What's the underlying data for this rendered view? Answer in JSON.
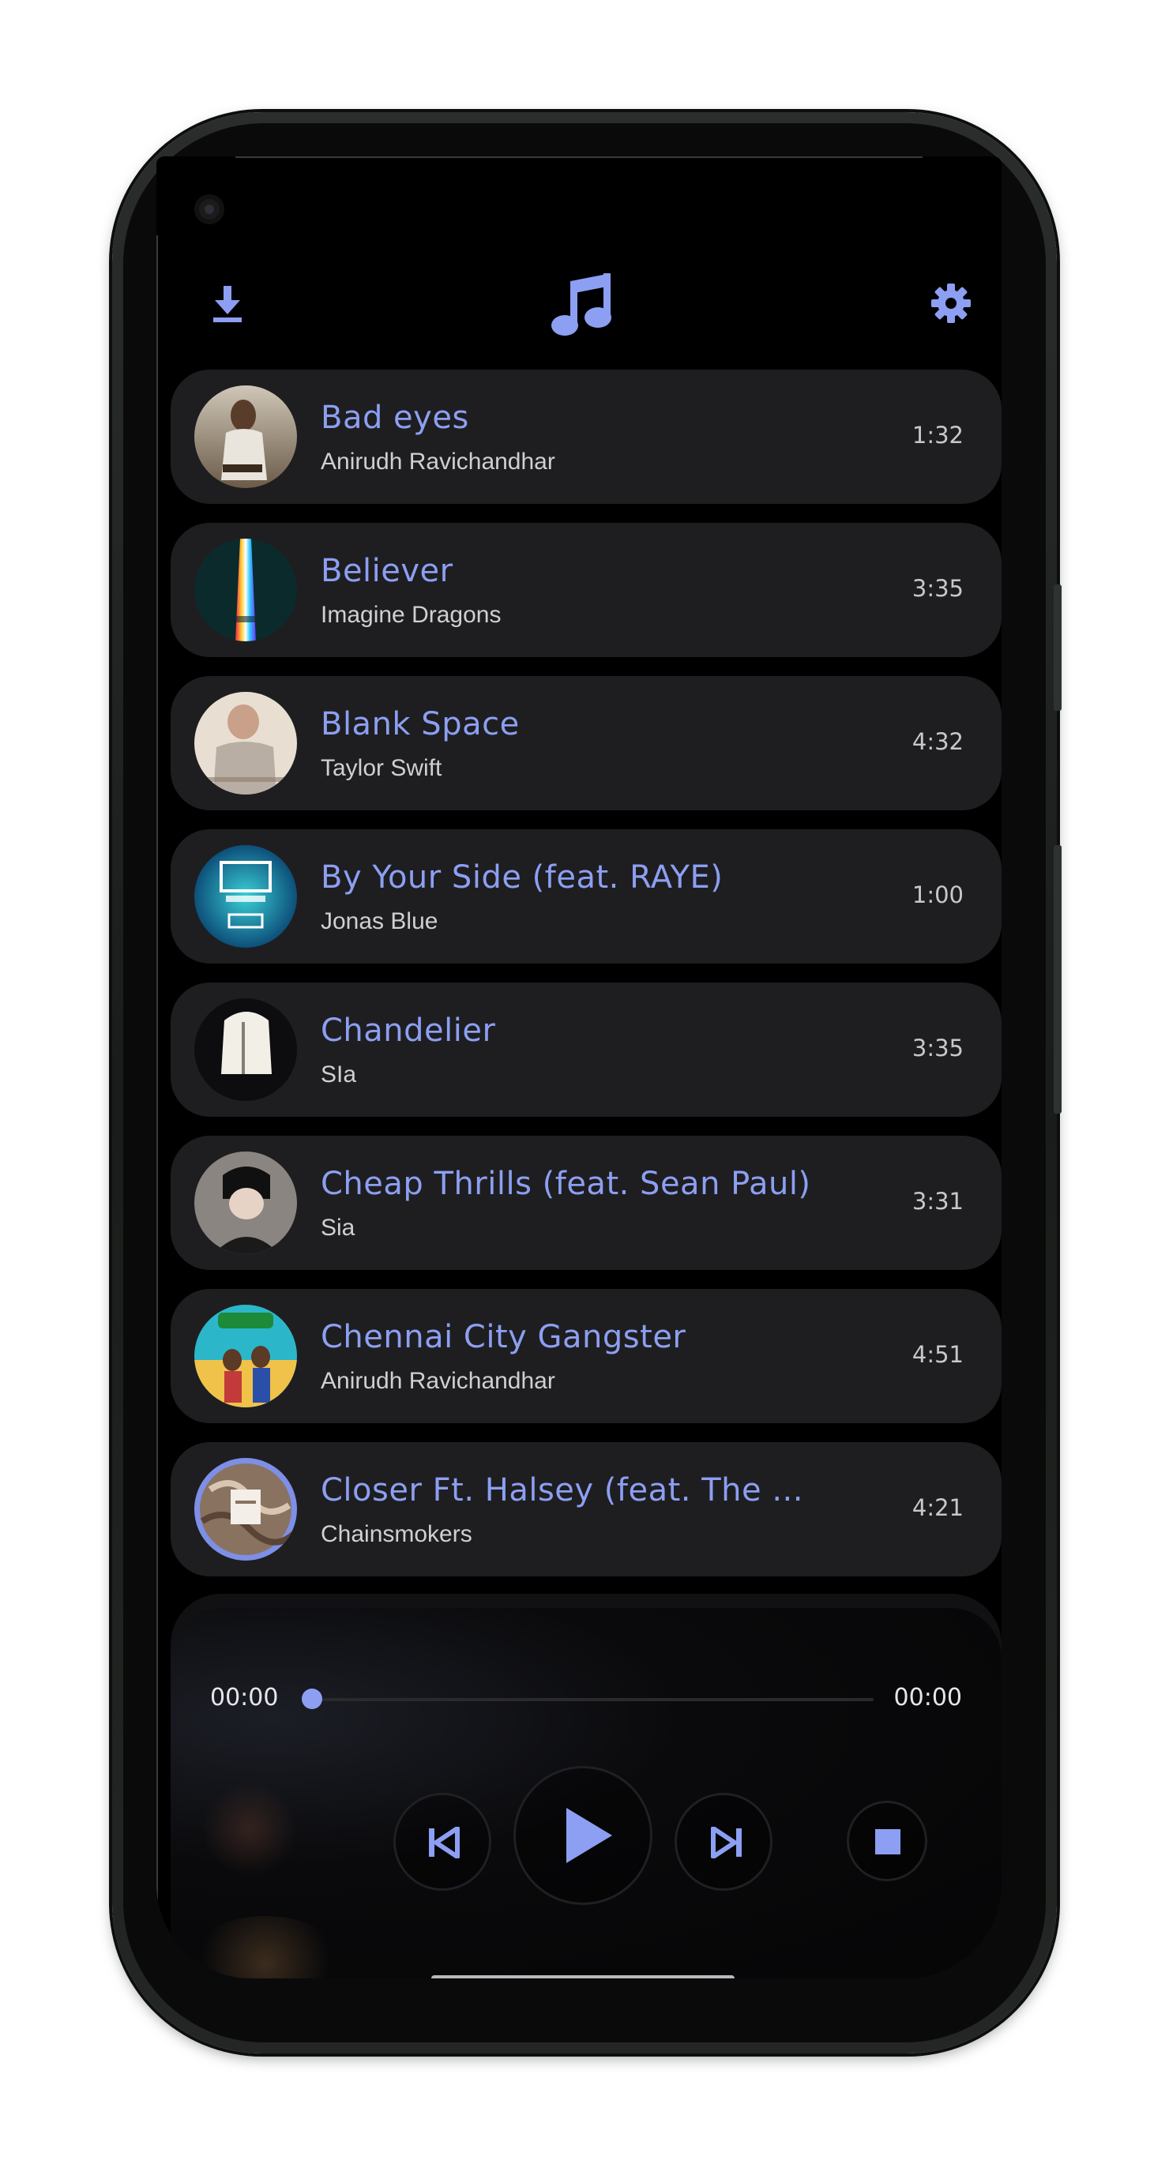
{
  "colors": {
    "accent": "#8c9ff2",
    "card_bg": "#1e1e20",
    "screen_bg": "#000000",
    "artist_text": "#cfcfd4"
  },
  "header": {
    "left_icon": "download-icon",
    "center_icon": "music-note-icon",
    "right_icon": "gear-icon"
  },
  "songs": [
    {
      "title": "Bad eyes",
      "artist": "Anirudh Ravichandhar",
      "duration": "1:32"
    },
    {
      "title": "Believer",
      "artist": "Imagine Dragons",
      "duration": "3:35"
    },
    {
      "title": "Blank Space",
      "artist": "Taylor Swift",
      "duration": "4:32"
    },
    {
      "title": "By Your Side (feat. RAYE)",
      "artist": "Jonas Blue",
      "duration": "1:00"
    },
    {
      "title": "Chandelier",
      "artist": "SIa",
      "duration": "3:35"
    },
    {
      "title": "Cheap Thrills (feat. Sean Paul)",
      "artist": "Sia",
      "duration": "3:31"
    },
    {
      "title": "Chennai City Gangster",
      "artist": "Anirudh Ravichandhar",
      "duration": "4:51"
    },
    {
      "title": "Closer Ft. Halsey (feat. The ...",
      "artist": "Chainsmokers",
      "duration": "4:21"
    }
  ],
  "player": {
    "elapsed": "00:00",
    "total": "00:00",
    "progress": 0,
    "controls": [
      "skip-previous-icon",
      "play-icon",
      "skip-next-icon",
      "stop-icon"
    ]
  }
}
